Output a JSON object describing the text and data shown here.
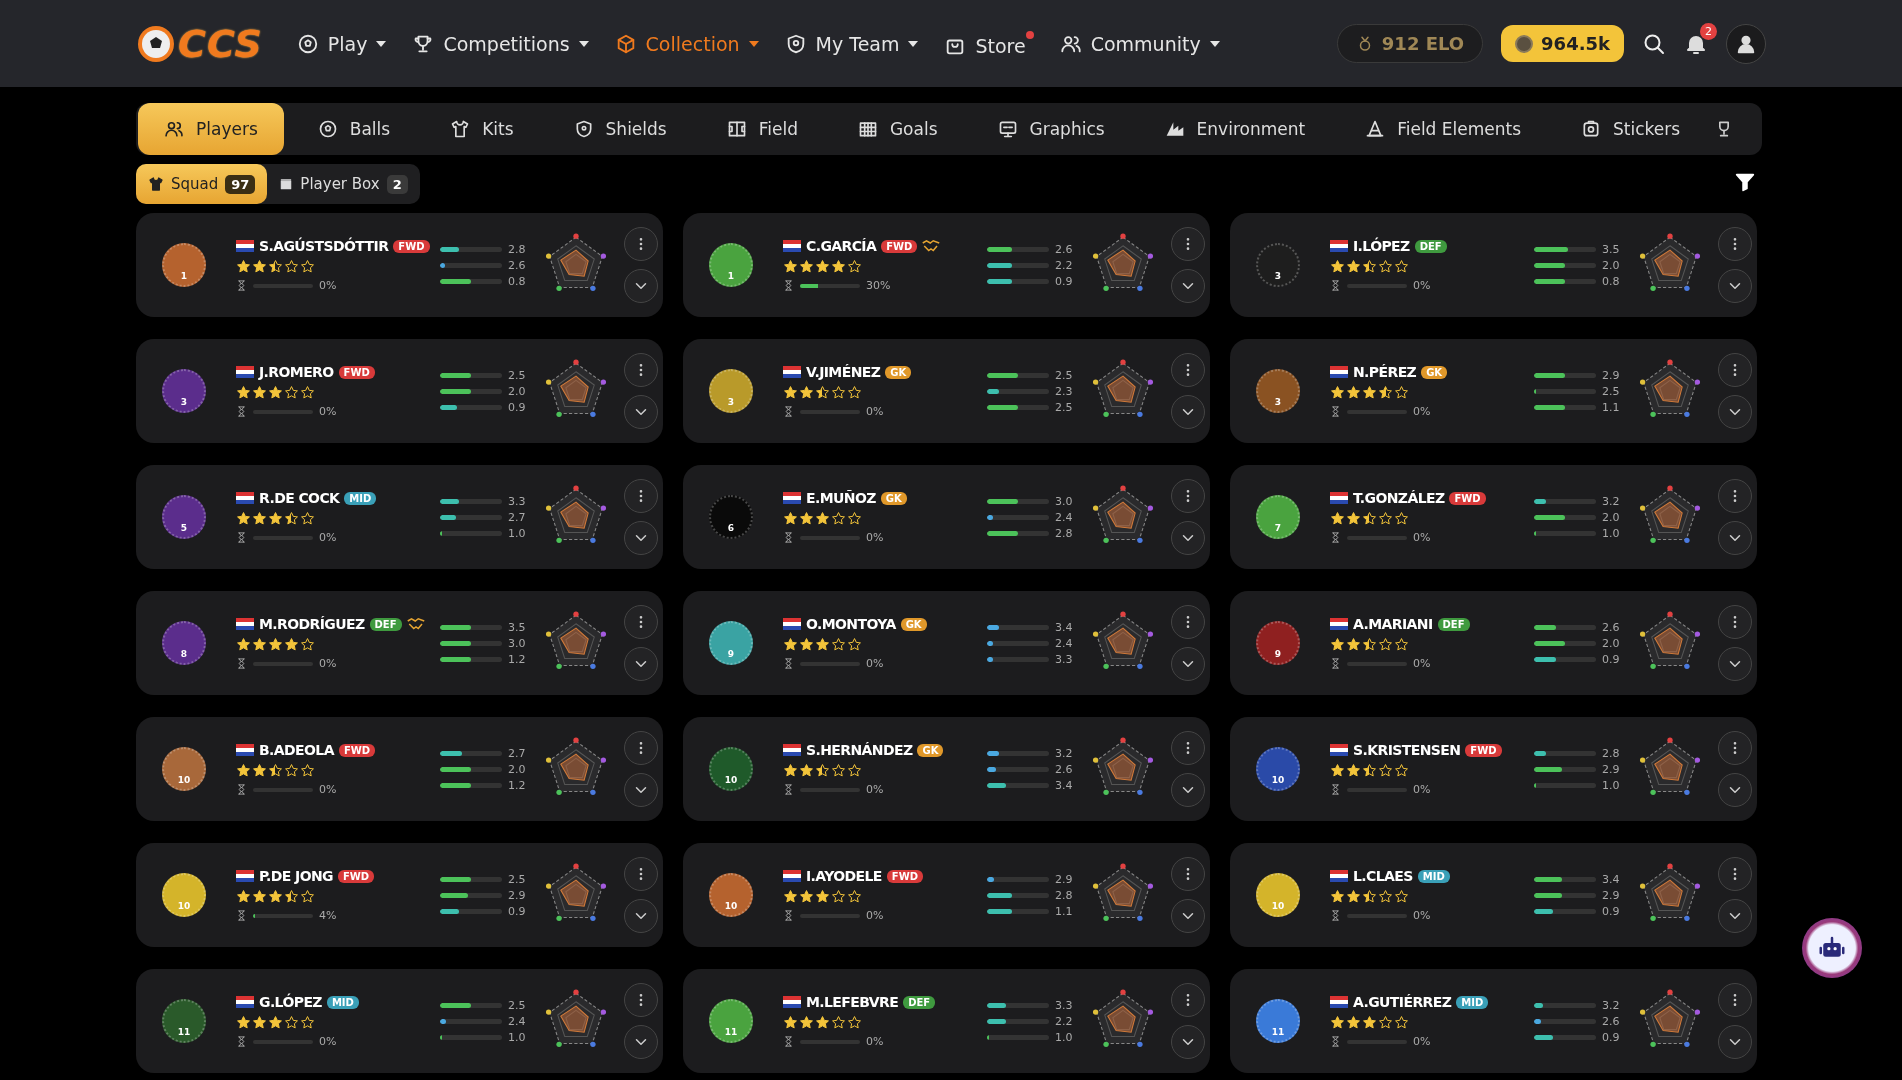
{
  "header": {
    "logo": "CCS",
    "nav": [
      {
        "label": "Play",
        "selected": false,
        "caret": true,
        "dot": false
      },
      {
        "label": "Competitions",
        "selected": false,
        "caret": true,
        "dot": false
      },
      {
        "label": "Collection",
        "selected": true,
        "caret": true,
        "dot": false
      },
      {
        "label": "My Team",
        "selected": false,
        "caret": true,
        "dot": false
      },
      {
        "label": "Store",
        "selected": false,
        "caret": false,
        "dot": true
      },
      {
        "label": "Community",
        "selected": false,
        "caret": true,
        "dot": false
      }
    ],
    "elo": "912 ELO",
    "coins": "964.5k",
    "notifications": "2"
  },
  "tabs": [
    {
      "label": "Players",
      "selected": true
    },
    {
      "label": "Balls",
      "selected": false
    },
    {
      "label": "Kits",
      "selected": false
    },
    {
      "label": "Shields",
      "selected": false
    },
    {
      "label": "Field",
      "selected": false
    },
    {
      "label": "Goals",
      "selected": false
    },
    {
      "label": "Graphics",
      "selected": false
    },
    {
      "label": "Environment",
      "selected": false
    },
    {
      "label": "Field Elements",
      "selected": false
    },
    {
      "label": "Stickers",
      "selected": false
    }
  ],
  "subtabs": [
    {
      "label": "Squad",
      "count": "97",
      "selected": true
    },
    {
      "label": "Player Box",
      "count": "2",
      "selected": false
    }
  ],
  "players": [
    {
      "name": "S.AGÚSTSDÓTTIR",
      "position": {
        "label": "FWD",
        "color": "#d83a3a"
      },
      "partner": false,
      "stars": 2.5,
      "progress": {
        "level": 0,
        "reading": "0%"
      },
      "cap": {
        "color": "#b5622e",
        "number": "1"
      },
      "stats": [
        {
          "value": "2.8",
          "level": 0.3,
          "color": "#3dbfae"
        },
        {
          "value": "2.6",
          "level": 0.08,
          "color": "#4aa8e0"
        },
        {
          "value": "0.8",
          "level": 0.5,
          "color": "#4cc25a"
        }
      ]
    },
    {
      "name": "C.GARCÍA",
      "position": {
        "label": "FWD",
        "color": "#d83a3a"
      },
      "partner": true,
      "stars": 4,
      "progress": {
        "level": 0.3,
        "reading": "30%"
      },
      "cap": {
        "color": "#4aa33f",
        "number": "1"
      },
      "stats": [
        {
          "value": "2.6",
          "level": 0.4,
          "color": "#4cc25a"
        },
        {
          "value": "2.2",
          "level": 0.4,
          "color": "#3dbfae"
        },
        {
          "value": "0.9",
          "level": 0.4,
          "color": "#3dbfae"
        }
      ]
    },
    {
      "name": "I.LÓPEZ",
      "position": {
        "label": "DEF",
        "color": "#3f9a3f"
      },
      "partner": false,
      "stars": 2.5,
      "progress": {
        "level": 0,
        "reading": "0%"
      },
      "cap": {
        "color": "#1e1e1e",
        "number": "3"
      },
      "stats": [
        {
          "value": "3.5",
          "level": 0.55,
          "color": "#4cc25a"
        },
        {
          "value": "2.0",
          "level": 0.5,
          "color": "#4cc25a"
        },
        {
          "value": "0.8",
          "level": 0.5,
          "color": "#4cc25a"
        }
      ]
    },
    {
      "name": "J.ROMERO",
      "position": {
        "label": "FWD",
        "color": "#d83a3a"
      },
      "partner": false,
      "stars": 3,
      "progress": {
        "level": 0,
        "reading": "0%"
      },
      "cap": {
        "color": "#5b2d8c",
        "number": "3"
      },
      "stats": [
        {
          "value": "2.5",
          "level": 0.5,
          "color": "#4cc25a"
        },
        {
          "value": "2.0",
          "level": 0.5,
          "color": "#4cc25a"
        },
        {
          "value": "0.9",
          "level": 0.28,
          "color": "#3dbfae"
        }
      ]
    },
    {
      "name": "V.JIMÉNEZ",
      "position": {
        "label": "GK",
        "color": "#e0982a"
      },
      "partner": false,
      "stars": 2.5,
      "progress": {
        "level": 0,
        "reading": "0%"
      },
      "cap": {
        "color": "#b99a2a",
        "number": "3"
      },
      "stats": [
        {
          "value": "2.5",
          "level": 0.5,
          "color": "#4cc25a"
        },
        {
          "value": "2.3",
          "level": 0.2,
          "color": "#3dbfae"
        },
        {
          "value": "2.5",
          "level": 0.5,
          "color": "#4cc25a"
        }
      ]
    },
    {
      "name": "N.PÉREZ",
      "position": {
        "label": "GK",
        "color": "#e0982a"
      },
      "partner": false,
      "stars": 3.5,
      "progress": {
        "level": 0,
        "reading": "0%"
      },
      "cap": {
        "color": "#8a5222",
        "number": "3"
      },
      "stats": [
        {
          "value": "2.9",
          "level": 0.5,
          "color": "#4cc25a"
        },
        {
          "value": "2.5",
          "level": 0.03,
          "color": "#4cc25a"
        },
        {
          "value": "1.1",
          "level": 0.5,
          "color": "#4cc25a"
        }
      ]
    },
    {
      "name": "R.DE COCK",
      "position": {
        "label": "MID",
        "color": "#3aa0b8"
      },
      "partner": false,
      "stars": 3.5,
      "progress": {
        "level": 0,
        "reading": "0%"
      },
      "cap": {
        "color": "#5b2d8c",
        "number": "5"
      },
      "stats": [
        {
          "value": "3.3",
          "level": 0.3,
          "color": "#3dbfae"
        },
        {
          "value": "2.7",
          "level": 0.25,
          "color": "#3dbfae"
        },
        {
          "value": "1.0",
          "level": 0.03,
          "color": "#4cc25a"
        }
      ]
    },
    {
      "name": "E.MUÑOZ",
      "position": {
        "label": "GK",
        "color": "#e0982a"
      },
      "partner": false,
      "stars": 3,
      "progress": {
        "level": 0,
        "reading": "0%"
      },
      "cap": {
        "color": "#0a0a0a",
        "number": "6"
      },
      "stats": [
        {
          "value": "3.0",
          "level": 0.5,
          "color": "#4cc25a"
        },
        {
          "value": "2.4",
          "level": 0.1,
          "color": "#4aa8e0"
        },
        {
          "value": "2.8",
          "level": 0.5,
          "color": "#4cc25a"
        }
      ]
    },
    {
      "name": "T.GONZÁLEZ",
      "position": {
        "label": "FWD",
        "color": "#d83a3a"
      },
      "partner": false,
      "stars": 2.5,
      "progress": {
        "level": 0,
        "reading": "0%"
      },
      "cap": {
        "color": "#4aa33f",
        "number": "7"
      },
      "stats": [
        {
          "value": "3.2",
          "level": 0.2,
          "color": "#3dbfae"
        },
        {
          "value": "2.0",
          "level": 0.5,
          "color": "#4cc25a"
        },
        {
          "value": "1.0",
          "level": 0.03,
          "color": "#4cc25a"
        }
      ]
    },
    {
      "name": "M.RODRÍGUEZ",
      "position": {
        "label": "DEF",
        "color": "#3f9a3f"
      },
      "partner": true,
      "stars": 4,
      "progress": {
        "level": 0,
        "reading": "0%"
      },
      "cap": {
        "color": "#5b2d8c",
        "number": "8"
      },
      "stats": [
        {
          "value": "3.5",
          "level": 0.5,
          "color": "#4cc25a"
        },
        {
          "value": "3.0",
          "level": 0.5,
          "color": "#4cc25a"
        },
        {
          "value": "1.2",
          "level": 0.5,
          "color": "#4cc25a"
        }
      ]
    },
    {
      "name": "O.MONTOYA",
      "position": {
        "label": "GK",
        "color": "#e0982a"
      },
      "partner": false,
      "stars": 3,
      "progress": {
        "level": 0,
        "reading": "0%"
      },
      "cap": {
        "color": "#3aa3a3",
        "number": "9"
      },
      "stats": [
        {
          "value": "3.4",
          "level": 0.2,
          "color": "#4aa8e0"
        },
        {
          "value": "2.4",
          "level": 0.1,
          "color": "#4aa8e0"
        },
        {
          "value": "3.3",
          "level": 0.1,
          "color": "#4aa8e0"
        }
      ]
    },
    {
      "name": "A.MARIANI",
      "position": {
        "label": "DEF",
        "color": "#3f9a3f"
      },
      "partner": false,
      "stars": 2.5,
      "progress": {
        "level": 0,
        "reading": "0%"
      },
      "cap": {
        "color": "#8f2020",
        "number": "9"
      },
      "stats": [
        {
          "value": "2.6",
          "level": 0.35,
          "color": "#4cc25a"
        },
        {
          "value": "2.0",
          "level": 0.5,
          "color": "#4cc25a"
        },
        {
          "value": "0.9",
          "level": 0.35,
          "color": "#3dbfae"
        }
      ]
    },
    {
      "name": "B.ADEOLA",
      "position": {
        "label": "FWD",
        "color": "#d83a3a"
      },
      "partner": false,
      "stars": 2.5,
      "progress": {
        "level": 0,
        "reading": "0%"
      },
      "cap": {
        "color": "#a8683a",
        "number": "10"
      },
      "stats": [
        {
          "value": "2.7",
          "level": 0.35,
          "color": "#3dbfae"
        },
        {
          "value": "2.0",
          "level": 0.5,
          "color": "#4cc25a"
        },
        {
          "value": "1.2",
          "level": 0.5,
          "color": "#4cc25a"
        }
      ]
    },
    {
      "name": "S.HERNÁNDEZ",
      "position": {
        "label": "GK",
        "color": "#e0982a"
      },
      "partner": false,
      "stars": 2.5,
      "progress": {
        "level": 0,
        "reading": "0%"
      },
      "cap": {
        "color": "#1f5a2a",
        "number": "10"
      },
      "stats": [
        {
          "value": "3.2",
          "level": 0.2,
          "color": "#4aa8e0"
        },
        {
          "value": "2.6",
          "level": 0.15,
          "color": "#4aa8e0"
        },
        {
          "value": "3.4",
          "level": 0.3,
          "color": "#3dbfae"
        }
      ]
    },
    {
      "name": "S.KRISTENSEN",
      "position": {
        "label": "FWD",
        "color": "#d83a3a"
      },
      "partner": false,
      "stars": 2.5,
      "progress": {
        "level": 0,
        "reading": "0%"
      },
      "cap": {
        "color": "#2a4aa8",
        "number": "10"
      },
      "stats": [
        {
          "value": "2.8",
          "level": 0.2,
          "color": "#3dbfae"
        },
        {
          "value": "2.9",
          "level": 0.45,
          "color": "#4cc25a"
        },
        {
          "value": "1.0",
          "level": 0.03,
          "color": "#4cc25a"
        }
      ]
    },
    {
      "name": "P.DE JONG",
      "position": {
        "label": "FWD",
        "color": "#d83a3a"
      },
      "partner": false,
      "stars": 3.5,
      "progress": {
        "level": 0.04,
        "reading": "4%"
      },
      "cap": {
        "color": "#d4b42a",
        "number": "10"
      },
      "stats": [
        {
          "value": "2.5",
          "level": 0.5,
          "color": "#4cc25a"
        },
        {
          "value": "2.9",
          "level": 0.45,
          "color": "#4cc25a"
        },
        {
          "value": "0.9",
          "level": 0.3,
          "color": "#3dbfae"
        }
      ]
    },
    {
      "name": "I.AYODELE",
      "position": {
        "label": "FWD",
        "color": "#d83a3a"
      },
      "partner": false,
      "stars": 3,
      "progress": {
        "level": 0,
        "reading": "0%"
      },
      "cap": {
        "color": "#b5622e",
        "number": "10"
      },
      "stats": [
        {
          "value": "2.9",
          "level": 0.12,
          "color": "#4aa8e0"
        },
        {
          "value": "2.8",
          "level": 0.4,
          "color": "#3dbfae"
        },
        {
          "value": "1.1",
          "level": 0.4,
          "color": "#3dbfae"
        }
      ]
    },
    {
      "name": "L.CLAES",
      "position": {
        "label": "MID",
        "color": "#3aa0b8"
      },
      "partner": false,
      "stars": 2.5,
      "progress": {
        "level": 0,
        "reading": "0%"
      },
      "cap": {
        "color": "#d4b42a",
        "number": "10"
      },
      "stats": [
        {
          "value": "3.4",
          "level": 0.45,
          "color": "#4cc25a"
        },
        {
          "value": "2.9",
          "level": 0.45,
          "color": "#4cc25a"
        },
        {
          "value": "0.9",
          "level": 0.3,
          "color": "#3dbfae"
        }
      ]
    },
    {
      "name": "G.LÓPEZ",
      "position": {
        "label": "MID",
        "color": "#3aa0b8"
      },
      "partner": false,
      "stars": 3,
      "progress": {
        "level": 0,
        "reading": "0%"
      },
      "cap": {
        "color": "#2a5a2a",
        "number": "11"
      },
      "stats": [
        {
          "value": "2.5",
          "level": 0.5,
          "color": "#4cc25a"
        },
        {
          "value": "2.4",
          "level": 0.1,
          "color": "#4aa8e0"
        },
        {
          "value": "1.0",
          "level": 0.03,
          "color": "#4cc25a"
        }
      ]
    },
    {
      "name": "M.LEFEBVRE",
      "position": {
        "label": "DEF",
        "color": "#3f9a3f"
      },
      "partner": false,
      "stars": 3,
      "progress": {
        "level": 0,
        "reading": "0%"
      },
      "cap": {
        "color": "#4aa33f",
        "number": "11"
      },
      "stats": [
        {
          "value": "3.3",
          "level": 0.3,
          "color": "#3dbfae"
        },
        {
          "value": "2.2",
          "level": 0.3,
          "color": "#3dbfae"
        },
        {
          "value": "1.0",
          "level": 0.03,
          "color": "#4cc25a"
        }
      ]
    },
    {
      "name": "A.GUTIÉRREZ",
      "position": {
        "label": "MID",
        "color": "#3aa0b8"
      },
      "partner": false,
      "stars": 3,
      "progress": {
        "level": 0,
        "reading": "0%"
      },
      "cap": {
        "color": "#3a7ad8",
        "number": "11"
      },
      "stats": [
        {
          "value": "3.2",
          "level": 0.15,
          "color": "#3dbfae"
        },
        {
          "value": "2.6",
          "level": 0.12,
          "color": "#4aa8e0"
        },
        {
          "value": "0.9",
          "level": 0.3,
          "color": "#3dbfae"
        }
      ]
    }
  ]
}
